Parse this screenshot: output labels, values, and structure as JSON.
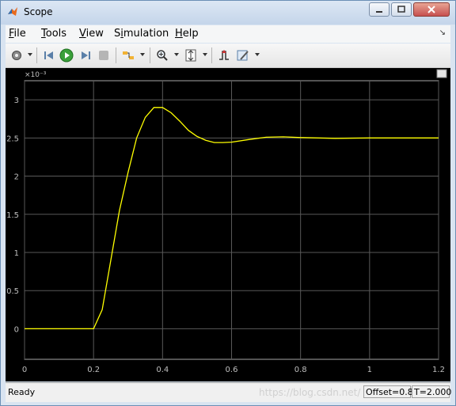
{
  "window": {
    "title": "Scope"
  },
  "menu": {
    "file_pre": "",
    "file_u": "F",
    "file_post": "ile",
    "tools_pre": "",
    "tools_u": "T",
    "tools_post": "ools",
    "view_pre": "",
    "view_u": "V",
    "view_post": "iew",
    "sim_pre": "S",
    "sim_u": "i",
    "sim_post": "mulation",
    "help_pre": "",
    "help_u": "H",
    "help_post": "elp"
  },
  "toolbar": {
    "icons": [
      "gear-icon",
      "step-back-icon",
      "run-icon",
      "step-forward-icon",
      "stop-icon",
      "signal-select-icon",
      "zoom-icon",
      "autoscale-icon",
      "trigger-icon",
      "style-icon"
    ]
  },
  "chart_data": {
    "type": "line",
    "title": "",
    "xlabel": "",
    "ylabel": "",
    "exponent_label": "×10⁻³",
    "xlim": [
      0,
      1.2
    ],
    "ylim": [
      -0.4,
      3.25
    ],
    "x_ticks": [
      "0",
      "0.2",
      "0.4",
      "0.6",
      "0.8",
      "1",
      "1.2"
    ],
    "x_tick_values": [
      0,
      0.2,
      0.4,
      0.6,
      0.8,
      1.0,
      1.2
    ],
    "y_ticks": [
      "0",
      "0.5",
      "1",
      "1.5",
      "2",
      "2.5",
      "3"
    ],
    "y_tick_values": [
      0,
      0.5,
      1.0,
      1.5,
      2.0,
      2.5,
      3.0
    ],
    "grid": true,
    "series": [
      {
        "color": "#ffff00",
        "x": [
          0,
          0.2,
          0.225,
          0.25,
          0.275,
          0.3,
          0.325,
          0.35,
          0.375,
          0.4,
          0.425,
          0.45,
          0.475,
          0.5,
          0.525,
          0.55,
          0.575,
          0.6,
          0.65,
          0.7,
          0.75,
          0.8,
          0.85,
          0.9,
          1.0,
          1.1,
          1.2
        ],
        "y": [
          0,
          0,
          0.25,
          0.9,
          1.55,
          2.05,
          2.5,
          2.77,
          2.9,
          2.9,
          2.83,
          2.72,
          2.6,
          2.52,
          2.47,
          2.44,
          2.44,
          2.445,
          2.48,
          2.51,
          2.515,
          2.505,
          2.5,
          2.495,
          2.5,
          2.5,
          2.5
        ]
      }
    ]
  },
  "status": {
    "ready": "Ready",
    "watermark": "https://blog.csdn.net/",
    "offset": "Offset=0.8",
    "time": "T=2.000"
  },
  "colors": {
    "plot_bg": "#000000",
    "grid": "#595959",
    "axis_text": "#bfbfbf",
    "line": "#ffff00"
  }
}
